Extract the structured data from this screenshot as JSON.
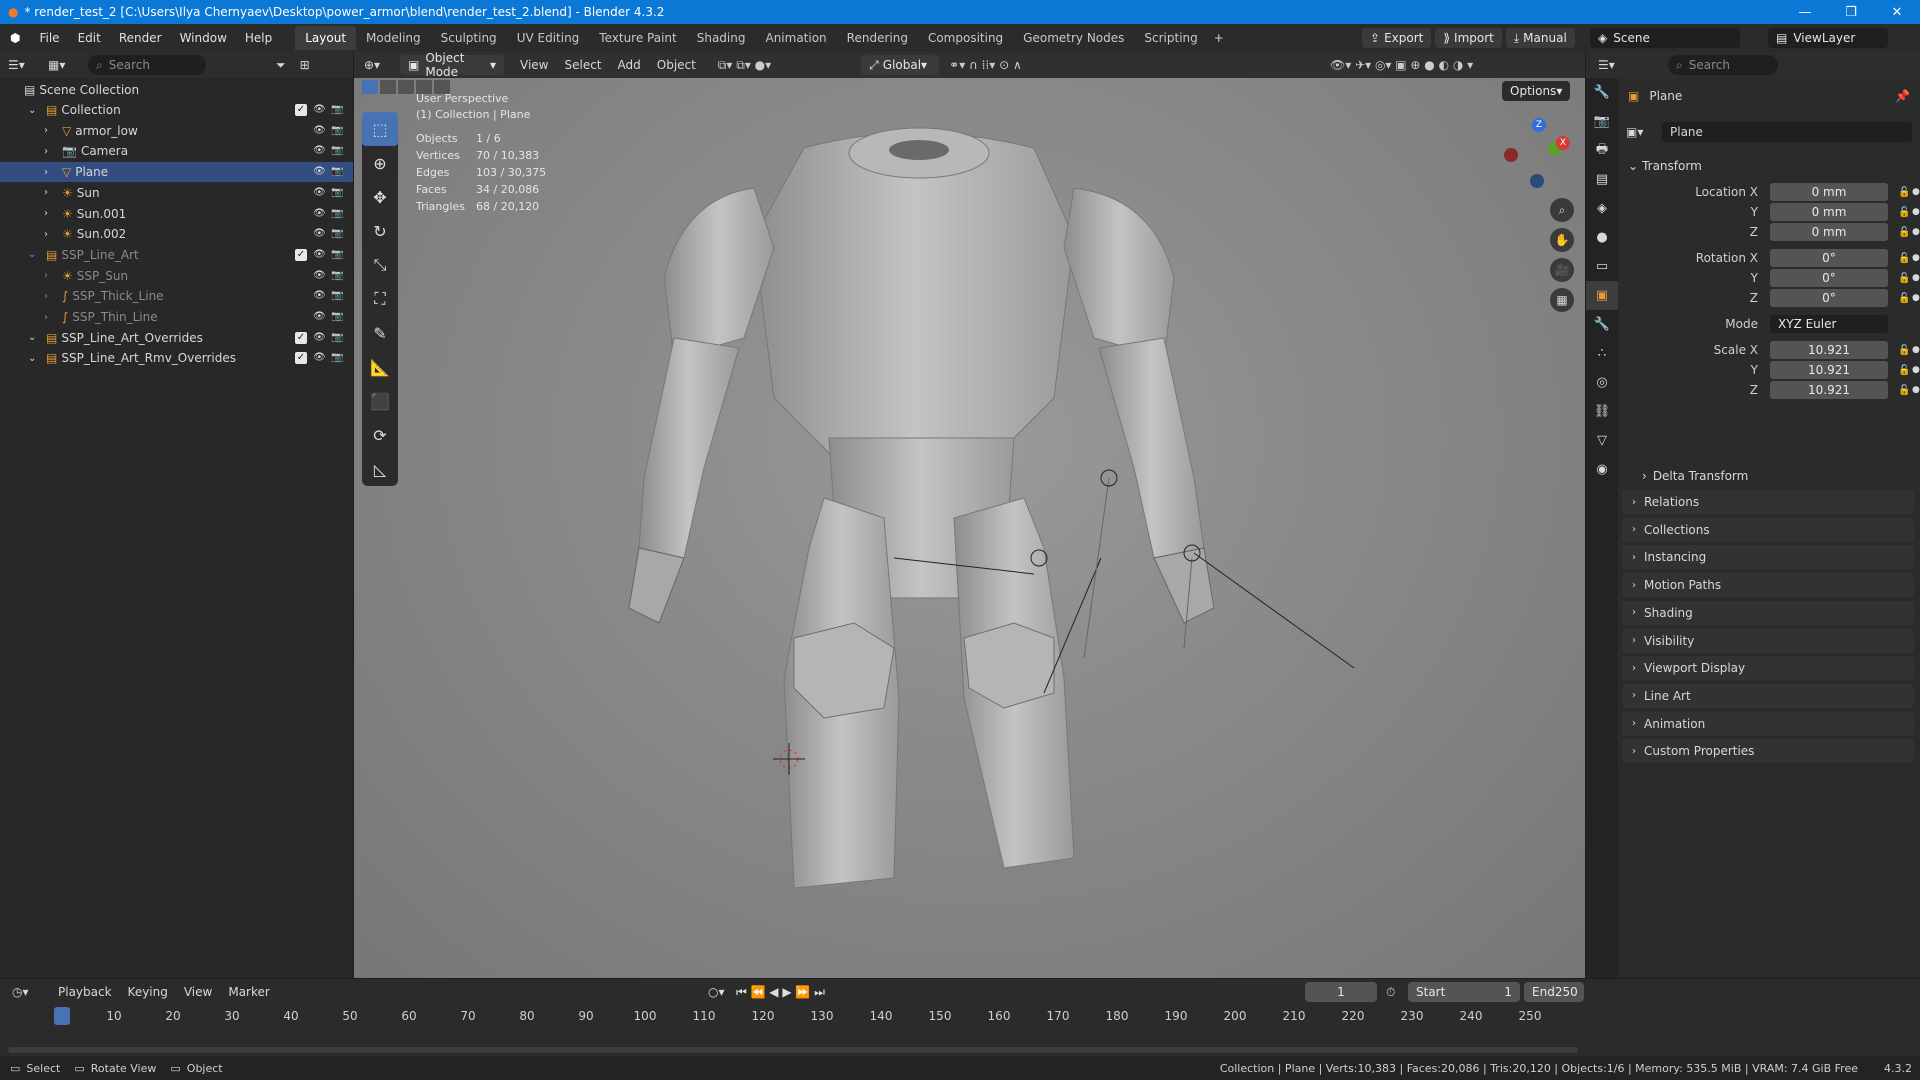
{
  "titlebar": {
    "title": "* render_test_2 [C:\\Users\\Ilya Chernyaev\\Desktop\\power_armor\\blend\\render_test_2.blend] - Blender 4.3.2"
  },
  "menu": [
    "File",
    "Edit",
    "Render",
    "Window",
    "Help"
  ],
  "workspaces": [
    "Layout",
    "Modeling",
    "Sculpting",
    "UV Editing",
    "Texture Paint",
    "Shading",
    "Animation",
    "Rendering",
    "Compositing",
    "Geometry Nodes",
    "Scripting"
  ],
  "topright": {
    "export": "Export",
    "import": "Import",
    "manual": "Manual",
    "scene": "Scene",
    "viewlayer": "ViewLayer"
  },
  "outliner": {
    "search_placeholder": "Search",
    "scene_collection": "Scene Collection",
    "items": [
      {
        "label": "Collection",
        "indent": 1,
        "dim": false
      },
      {
        "label": "armor_low",
        "indent": 2,
        "dim": false
      },
      {
        "label": "Camera",
        "indent": 2,
        "dim": false
      },
      {
        "label": "Plane",
        "indent": 2,
        "dim": false,
        "selected": true
      },
      {
        "label": "Sun",
        "indent": 2,
        "dim": false
      },
      {
        "label": "Sun.001",
        "indent": 2,
        "dim": false
      },
      {
        "label": "Sun.002",
        "indent": 2,
        "dim": false
      },
      {
        "label": "SSP_Line_Art",
        "indent": 1,
        "dim": true
      },
      {
        "label": "SSP_Sun",
        "indent": 2,
        "dim": true
      },
      {
        "label": "SSP_Thick_Line",
        "indent": 2,
        "dim": true
      },
      {
        "label": "SSP_Thin_Line",
        "indent": 2,
        "dim": true
      },
      {
        "label": "SSP_Line_Art_Overrides",
        "indent": 1,
        "dim": false
      },
      {
        "label": "SSP_Line_Art_Rmv_Overrides",
        "indent": 1,
        "dim": false
      }
    ]
  },
  "viewport": {
    "mode": "Object Mode",
    "menus": [
      "View",
      "Select",
      "Add",
      "Object"
    ],
    "orientation": "Global",
    "options": "Options",
    "perspective": "User Perspective",
    "context": "(1) Collection | Plane",
    "stats": [
      {
        "k": "Objects",
        "v": "1 / 6"
      },
      {
        "k": "Vertices",
        "v": "70 / 10,383"
      },
      {
        "k": "Edges",
        "v": "103 / 30,375"
      },
      {
        "k": "Faces",
        "v": "34 / 20,086"
      },
      {
        "k": "Triangles",
        "v": "68 / 20,120"
      }
    ]
  },
  "properties": {
    "search_placeholder": "Search",
    "object_name": "Plane",
    "datablock": "Plane",
    "transform_label": "Transform",
    "location": {
      "label": "Location X",
      "x": "0 mm",
      "y": "0 mm",
      "z": "0 mm"
    },
    "rotation": {
      "label": "Rotation X",
      "x": "0°",
      "y": "0°",
      "z": "0°"
    },
    "mode": {
      "label": "Mode",
      "value": "XYZ Euler"
    },
    "scale": {
      "label": "Scale X",
      "x": "10.921",
      "y": "10.921",
      "z": "10.921"
    },
    "axis_y": "Y",
    "axis_z": "Z",
    "delta": "Delta Transform",
    "panels": [
      "Relations",
      "Collections",
      "Instancing",
      "Motion Paths",
      "Shading",
      "Visibility",
      "Viewport Display",
      "Line Art",
      "Animation",
      "Custom Properties"
    ]
  },
  "timeline": {
    "menus": [
      "Playback",
      "Keying",
      "View",
      "Marker"
    ],
    "current": "1",
    "start_label": "Start",
    "start": "1",
    "end_label": "End",
    "end": "250",
    "ticks": [
      "1",
      "10",
      "20",
      "30",
      "40",
      "50",
      "60",
      "70",
      "80",
      "90",
      "100",
      "110",
      "120",
      "130",
      "140",
      "150",
      "160",
      "170",
      "180",
      "190",
      "200",
      "210",
      "220",
      "230",
      "240",
      "250"
    ]
  },
  "statusbar": {
    "select": "Select",
    "rotate": "Rotate View",
    "object": "Object",
    "info": "Collection | Plane | Verts:10,383 | Faces:20,086 | Tris:20,120 | Objects:1/6 | Memory: 535.5 MiB | VRAM: 7.4 GiB Free",
    "version": "4.3.2"
  }
}
